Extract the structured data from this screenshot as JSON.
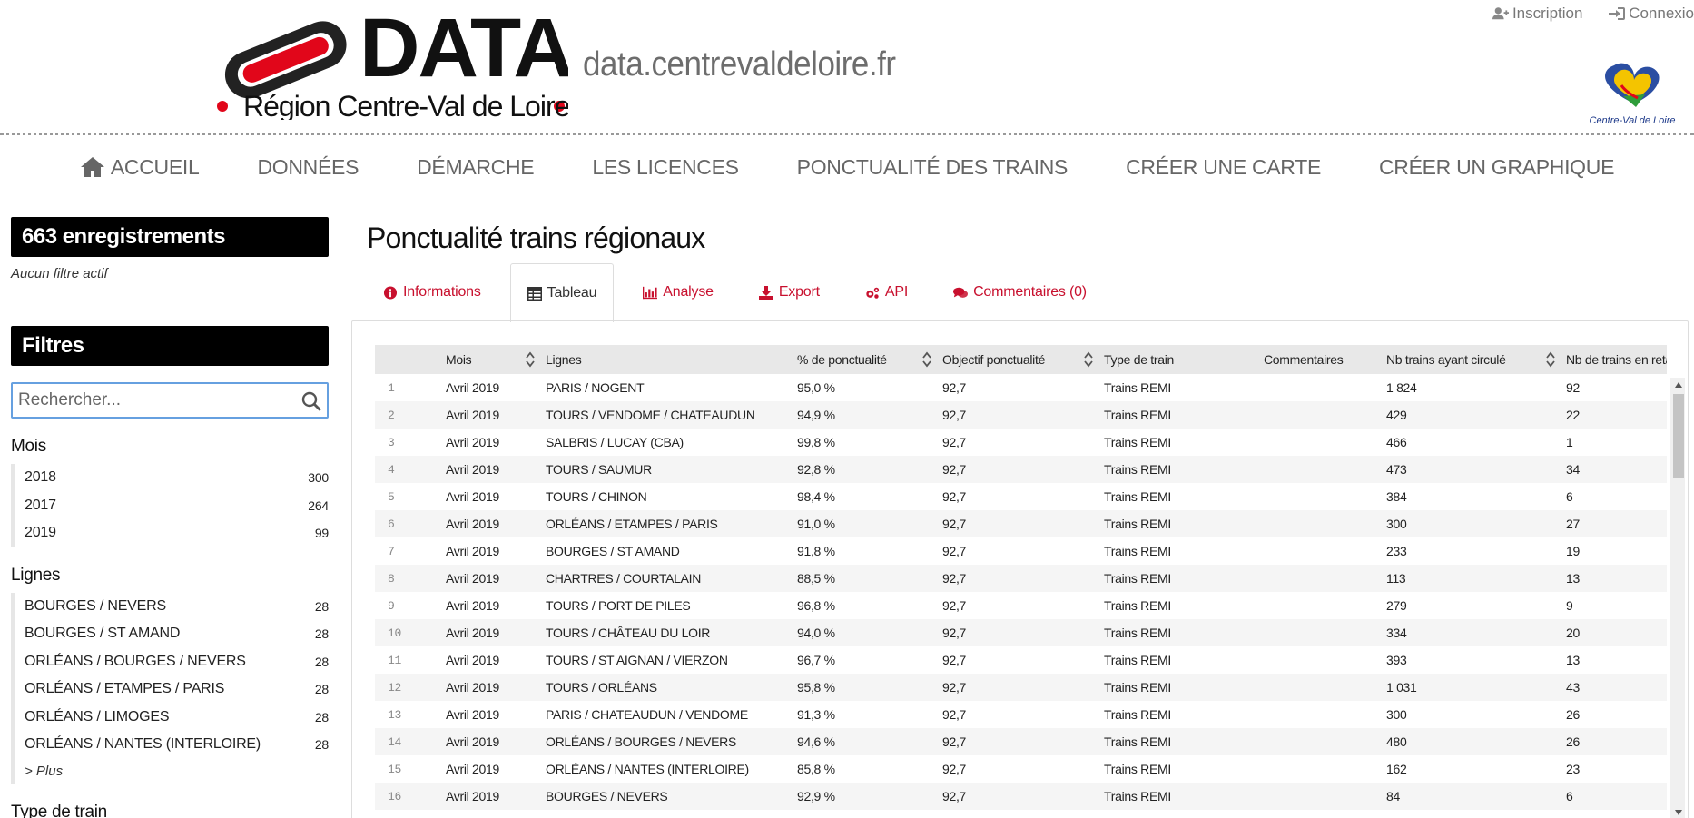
{
  "header": {
    "logo": {
      "word": "DATA",
      "region": "Région Centre-Val de Loire"
    },
    "domain": "data.centrevaldeloire.fr",
    "user_links": [
      {
        "label": "Inscription",
        "icon": "user-plus-icon"
      },
      {
        "label": "Connexio",
        "icon": "sign-in-icon"
      }
    ],
    "region_logo_text": "Centre-Val de Loire"
  },
  "nav": {
    "items": [
      {
        "label": "ACCUEIL",
        "icon": "home-icon"
      },
      {
        "label": "DONNÉES"
      },
      {
        "label": "DÉMARCHE"
      },
      {
        "label": "LES LICENCES"
      },
      {
        "label": "PONCTUALITÉ DES TRAINS"
      },
      {
        "label": "CRÉER UNE CARTE"
      },
      {
        "label": "CRÉER UN GRAPHIQUE"
      }
    ]
  },
  "sidebar": {
    "records": "663 enregistrements",
    "filter_state": "Aucun filtre actif",
    "filters_title": "Filtres",
    "search_placeholder": "Rechercher...",
    "facets": [
      {
        "title": "Mois",
        "items": [
          {
            "label": "2018",
            "count": "300"
          },
          {
            "label": "2017",
            "count": "264"
          },
          {
            "label": "2019",
            "count": "99"
          }
        ]
      },
      {
        "title": "Lignes",
        "items": [
          {
            "label": "BOURGES / NEVERS",
            "count": "28"
          },
          {
            "label": "BOURGES / ST AMAND",
            "count": "28"
          },
          {
            "label": "ORLÉANS / BOURGES / NEVERS",
            "count": "28"
          },
          {
            "label": "ORLÉANS / ETAMPES / PARIS",
            "count": "28"
          },
          {
            "label": "ORLÉANS / LIMOGES",
            "count": "28"
          },
          {
            "label": "ORLÉANS / NANTES (INTERLOIRE)",
            "count": "28"
          }
        ],
        "more": "> Plus"
      },
      {
        "title": "Type de train",
        "items": []
      }
    ]
  },
  "main": {
    "title": "Ponctualité trains régionaux",
    "tabs": [
      {
        "label": "Informations",
        "icon": "info-circle-icon",
        "active": false
      },
      {
        "label": "Tableau",
        "icon": "table-icon",
        "active": true
      },
      {
        "label": "Analyse",
        "icon": "bar-chart-icon",
        "active": false
      },
      {
        "label": "Export",
        "icon": "download-icon",
        "active": false
      },
      {
        "label": "API",
        "icon": "cogs-icon",
        "active": false
      },
      {
        "label": "Commentaires (0)",
        "icon": "comments-icon",
        "active": false
      }
    ],
    "table": {
      "columns": [
        {
          "label": "",
          "sortable": false
        },
        {
          "label": "Mois",
          "sortable": true
        },
        {
          "label": "Lignes",
          "sortable": false
        },
        {
          "label": "% de ponctualité",
          "sortable": true
        },
        {
          "label": "Objectif ponctualité",
          "sortable": true
        },
        {
          "label": "Type de train",
          "sortable": false
        },
        {
          "label": "Commentaires",
          "sortable": false
        },
        {
          "label": "Nb trains ayant circulé",
          "sortable": true
        },
        {
          "label": "Nb de trains en reta",
          "sortable": false
        }
      ],
      "rows": [
        [
          "1",
          "Avril 2019",
          "PARIS / NOGENT",
          "95,0 %",
          "92,7",
          "Trains REMI",
          "",
          "1 824",
          "92"
        ],
        [
          "2",
          "Avril 2019",
          "TOURS / VENDOME / CHATEAUDUN",
          "94,9 %",
          "92,7",
          "Trains REMI",
          "",
          "429",
          "22"
        ],
        [
          "3",
          "Avril 2019",
          "SALBRIS / LUCAY (CBA)",
          "99,8 %",
          "92,7",
          "Trains REMI",
          "",
          "466",
          "1"
        ],
        [
          "4",
          "Avril 2019",
          "TOURS / SAUMUR",
          "92,8 %",
          "92,7",
          "Trains REMI",
          "",
          "473",
          "34"
        ],
        [
          "5",
          "Avril 2019",
          "TOURS / CHINON",
          "98,4 %",
          "92,7",
          "Trains REMI",
          "",
          "384",
          "6"
        ],
        [
          "6",
          "Avril 2019",
          "ORLÉANS / ETAMPES / PARIS",
          "91,0 %",
          "92,7",
          "Trains REMI",
          "",
          "300",
          "27"
        ],
        [
          "7",
          "Avril 2019",
          "BOURGES / ST AMAND",
          "91,8 %",
          "92,7",
          "Trains REMI",
          "",
          "233",
          "19"
        ],
        [
          "8",
          "Avril 2019",
          "CHARTRES / COURTALAIN",
          "88,5 %",
          "92,7",
          "Trains REMI",
          "",
          "113",
          "13"
        ],
        [
          "9",
          "Avril 2019",
          "TOURS / PORT DE PILES",
          "96,8 %",
          "92,7",
          "Trains REMI",
          "",
          "279",
          "9"
        ],
        [
          "10",
          "Avril 2019",
          "TOURS / CHÂTEAU DU LOIR",
          "94,0 %",
          "92,7",
          "Trains REMI",
          "",
          "334",
          "20"
        ],
        [
          "11",
          "Avril 2019",
          "TOURS / ST AIGNAN / VIERZON",
          "96,7 %",
          "92,7",
          "Trains REMI",
          "",
          "393",
          "13"
        ],
        [
          "12",
          "Avril 2019",
          "TOURS / ORLÉANS",
          "95,8 %",
          "92,7",
          "Trains REMI",
          "",
          "1 031",
          "43"
        ],
        [
          "13",
          "Avril 2019",
          "PARIS / CHATEAUDUN / VENDOME",
          "91,3 %",
          "92,7",
          "Trains REMI",
          "",
          "300",
          "26"
        ],
        [
          "14",
          "Avril 2019",
          "ORLÉANS / BOURGES / NEVERS",
          "94,6 %",
          "92,7",
          "Trains REMI",
          "",
          "480",
          "26"
        ],
        [
          "15",
          "Avril 2019",
          "ORLÉANS / NANTES (INTERLOIRE)",
          "85,8 %",
          "92,7",
          "Trains REMI",
          "",
          "162",
          "23"
        ],
        [
          "16",
          "Avril 2019",
          "BOURGES / NEVERS",
          "92,9 %",
          "92,7",
          "Trains REMI",
          "",
          "84",
          "6"
        ]
      ]
    }
  },
  "colors": {
    "accent_red": "#c8102e",
    "nav_text": "#666666",
    "focus_blue": "#66a0e0"
  }
}
